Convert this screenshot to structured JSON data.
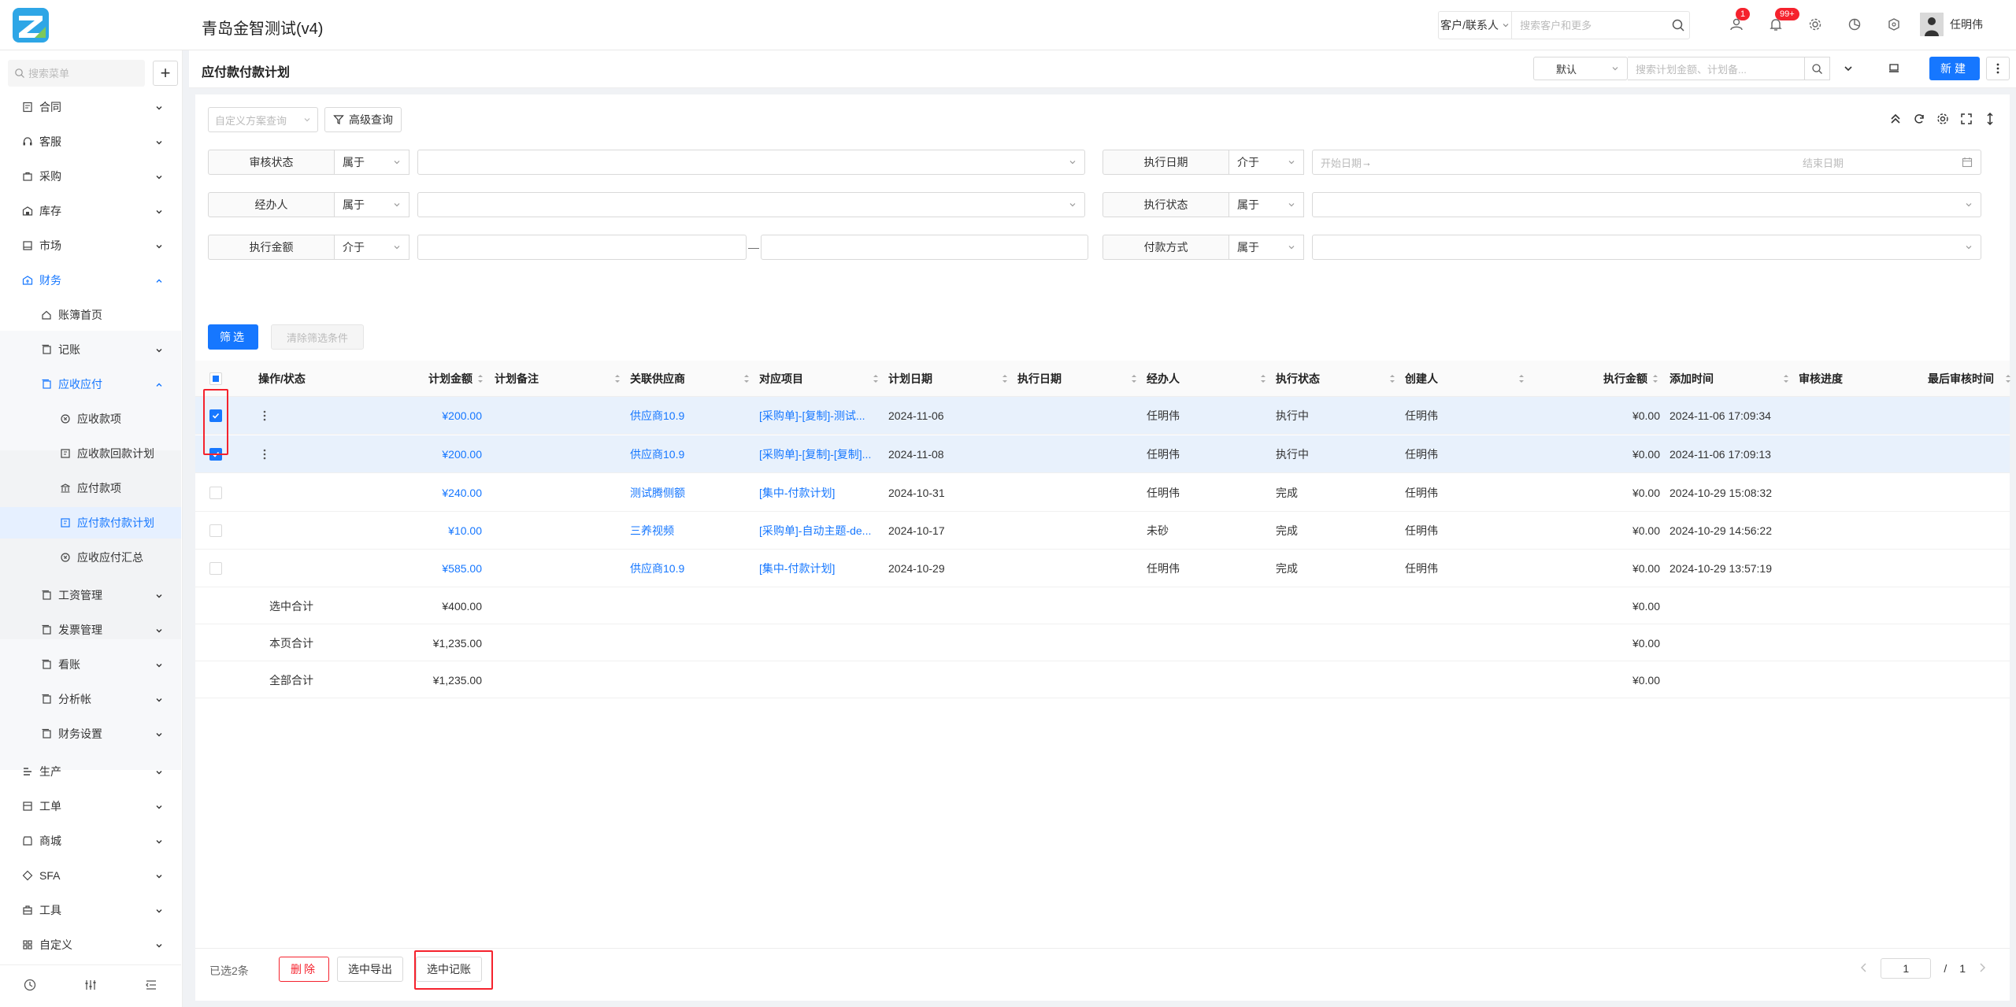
{
  "app": {
    "title": "青岛金智测试(v4)"
  },
  "top_search": {
    "type_label": "客户/联系人",
    "placeholder": "搜索客户和更多"
  },
  "notifications": {
    "message_badge": "1",
    "bell_badge": "99+"
  },
  "user": {
    "name": "任明伟"
  },
  "sidebar": {
    "search_placeholder": "搜索菜单",
    "items": [
      {
        "label": "合同",
        "icon": "contract-icon"
      },
      {
        "label": "客服",
        "icon": "headset-icon"
      },
      {
        "label": "采购",
        "icon": "cart-icon"
      },
      {
        "label": "库存",
        "icon": "warehouse-icon"
      },
      {
        "label": "市场",
        "icon": "market-icon"
      },
      {
        "label": "财务",
        "icon": "finance-icon"
      },
      {
        "label": "账簿首页",
        "icon": "home-icon"
      },
      {
        "label": "记账",
        "icon": "ledger-icon"
      },
      {
        "label": "应收应付",
        "icon": "ledger-icon"
      },
      {
        "label": "应收款项",
        "icon": "money-icon"
      },
      {
        "label": "应收款回款计划",
        "icon": "plan-icon"
      },
      {
        "label": "应付款项",
        "icon": "bank-icon"
      },
      {
        "label": "应付款付款计划",
        "icon": "plan-icon"
      },
      {
        "label": "应收应付汇总",
        "icon": "money-icon"
      },
      {
        "label": "工资管理",
        "icon": "ledger-icon"
      },
      {
        "label": "发票管理",
        "icon": "ledger-icon"
      },
      {
        "label": "看账",
        "icon": "ledger-icon"
      },
      {
        "label": "分析帐",
        "icon": "ledger-icon"
      },
      {
        "label": "财务设置",
        "icon": "ledger-icon"
      },
      {
        "label": "生产",
        "icon": "production-icon"
      },
      {
        "label": "工单",
        "icon": "workorder-icon"
      },
      {
        "label": "商城",
        "icon": "shop-icon"
      },
      {
        "label": "SFA",
        "icon": "sfa-icon"
      },
      {
        "label": "工具",
        "icon": "tools-icon"
      },
      {
        "label": "自定义",
        "icon": "grid-icon"
      }
    ]
  },
  "page": {
    "title": "应付款付款计划",
    "view": "默认",
    "search_placeholder": "搜索计划金额、计划备...",
    "new_label": "新建"
  },
  "filters": {
    "scheme_placeholder": "自定义方案查询",
    "advanced_label": "高级查询",
    "rows": [
      {
        "label": "审核状态",
        "op": "属于"
      },
      {
        "label": "执行日期",
        "op": "介于",
        "start": "开始日期",
        "end": "结束日期"
      },
      {
        "label": "经办人",
        "op": "属于"
      },
      {
        "label": "执行状态",
        "op": "属于"
      },
      {
        "label": "执行金额",
        "op": "介于"
      },
      {
        "label": "付款方式",
        "op": "属于"
      }
    ],
    "filter_btn": "筛选",
    "clear_btn": "清除筛选条件",
    "range_sep": "—",
    "date_sep": "→"
  },
  "table": {
    "columns": [
      "操作/状态",
      "计划金额",
      "计划备注",
      "关联供应商",
      "对应项目",
      "计划日期",
      "执行日期",
      "经办人",
      "执行状态",
      "创建人",
      "执行金额",
      "添加时间",
      "审核进度",
      "最后审核时间"
    ],
    "rows": [
      {
        "amount": "¥200.00",
        "note": "",
        "supplier": "供应商10.9",
        "project": "[采购单]-[复制]-测试...",
        "plan_date": "2024-11-06",
        "exec_date": "",
        "handler": "任明伟",
        "status": "执行中",
        "creator": "任明伟",
        "exec_amount": "¥0.00",
        "added": "2024-11-06 17:09:34",
        "checked": true
      },
      {
        "amount": "¥200.00",
        "note": "",
        "supplier": "供应商10.9",
        "project": "[采购单]-[复制]-[复制]...",
        "plan_date": "2024-11-08",
        "exec_date": "",
        "handler": "任明伟",
        "status": "执行中",
        "creator": "任明伟",
        "exec_amount": "¥0.00",
        "added": "2024-11-06 17:09:13",
        "checked": true
      },
      {
        "amount": "¥240.00",
        "note": "",
        "supplier": "测试腾侧额",
        "project": "[集中-付款计划]",
        "plan_date": "2024-10-31",
        "exec_date": "",
        "handler": "任明伟",
        "status": "完成",
        "creator": "任明伟",
        "exec_amount": "¥0.00",
        "added": "2024-10-29 15:08:32",
        "checked": false
      },
      {
        "amount": "¥10.00",
        "note": "",
        "supplier": "三养视频",
        "project": "[采购单]-自动主题-de...",
        "plan_date": "2024-10-17",
        "exec_date": "",
        "handler": "未砂",
        "status": "完成",
        "creator": "任明伟",
        "exec_amount": "¥0.00",
        "added": "2024-10-29 14:56:22",
        "checked": false
      },
      {
        "amount": "¥585.00",
        "note": "",
        "supplier": "供应商10.9",
        "project": "[集中-付款计划]",
        "plan_date": "2024-10-29",
        "exec_date": "",
        "handler": "任明伟",
        "status": "完成",
        "creator": "任明伟",
        "exec_amount": "¥0.00",
        "added": "2024-10-29 13:57:19",
        "checked": false
      }
    ],
    "summaries": [
      {
        "label": "选中合计",
        "amount": "¥400.00",
        "exec_amount": "¥0.00"
      },
      {
        "label": "本页合计",
        "amount": "¥1,235.00",
        "exec_amount": "¥0.00"
      },
      {
        "label": "全部合计",
        "amount": "¥1,235.00",
        "exec_amount": "¥0.00"
      }
    ]
  },
  "footer": {
    "selected": "已选2条",
    "delete": "删除",
    "export": "选中导出",
    "record": "选中记账",
    "page": "1",
    "sep": "/",
    "total_pages": "1"
  },
  "colors": {
    "accent": "#1677ff",
    "danger": "#f5222d",
    "selected_row": "#e8f1fc"
  }
}
